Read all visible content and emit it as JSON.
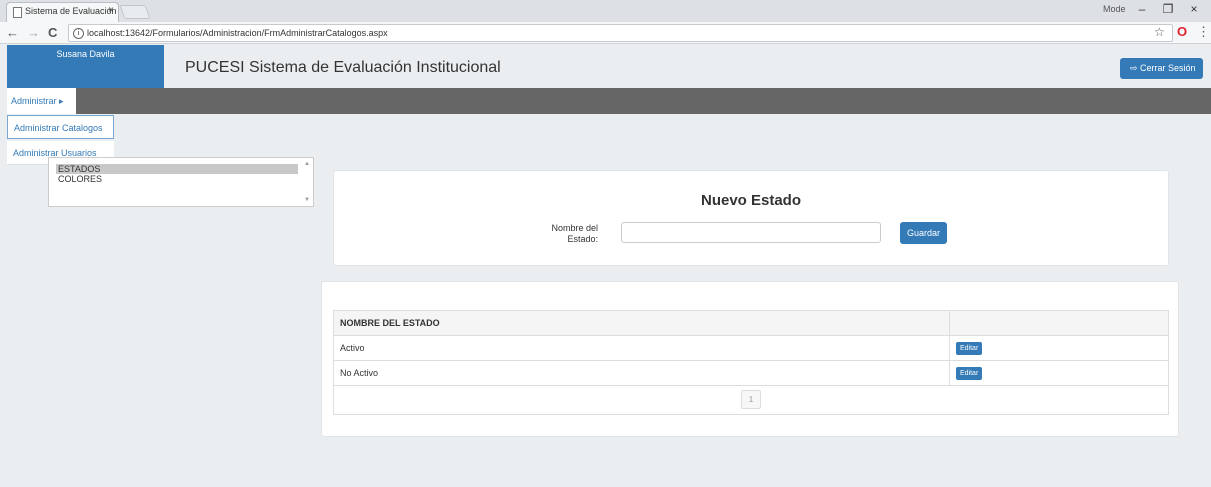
{
  "browser": {
    "tab_title": "Sistema de Evaluación In",
    "tab_close": "×",
    "address": "localhost:13642/Formularios/Administracion/FrmAdministrarCatalogos.aspx",
    "profile_label": "Mode",
    "minimize": "–",
    "restore": "❐",
    "close": "×",
    "back": "←",
    "forward": "→",
    "reload": "C",
    "info_symbol": "i",
    "star": "☆",
    "opera": "O",
    "menu": "⋮"
  },
  "header": {
    "user_name": "Susana Davila",
    "app_title": "PUCESI Sistema de Evaluación Institucional",
    "logout_label": "⇨ Cerrar Sesión"
  },
  "nav": {
    "admin_menu": "Administrar ▸",
    "dropdown_items": [
      "Administrar Catalogos",
      "Administrar Usuarios"
    ]
  },
  "catalog_list": {
    "options": [
      "ESTADOS",
      "COLORES"
    ],
    "selected_index": 0,
    "scroll_up": "▲",
    "scroll_down": "▼"
  },
  "form": {
    "title": "Nuevo Estado",
    "label": "Nombre del Estado:",
    "input_value": "",
    "submit_label": "Guardar"
  },
  "table": {
    "headers": [
      "NOMBRE DEL ESTADO",
      ""
    ],
    "rows": [
      {
        "name": "Activo",
        "action": "Editar"
      },
      {
        "name": "No Activo",
        "action": "Editar"
      }
    ],
    "current_page": "1"
  },
  "colors": {
    "primary": "#337ab7",
    "navbar": "#666666",
    "background": "#ebeef1"
  }
}
